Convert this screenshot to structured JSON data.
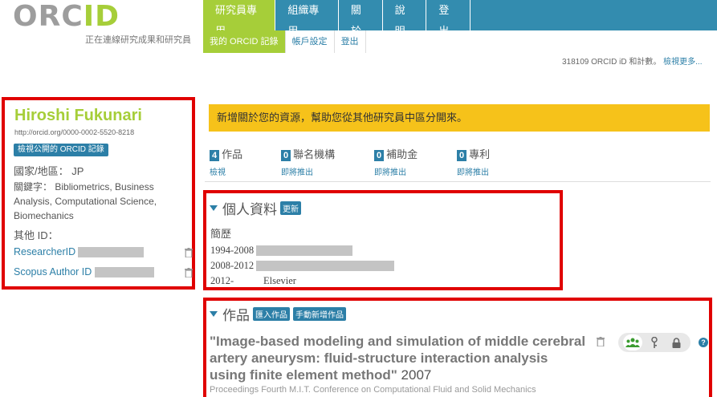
{
  "logo": {
    "brand": "ORCID",
    "tagline": "正在連線研究成果和研究員"
  },
  "nav": {
    "main": [
      "研究員專用",
      "組織專用",
      "關於",
      "說明",
      "登出"
    ],
    "sub": [
      "我的 ORCID 記錄",
      "帳戶設定",
      "登出"
    ],
    "count_text": "318109 ORCID iD 和計數。",
    "count_link": "檢視更多..."
  },
  "profile": {
    "name": "Hiroshi Fukunari",
    "orcid_url": "http://orcid.org/0000-0002-5520-8218",
    "public_button": "檢視公開的 ORCID 記錄",
    "country_label": "國家/地區：",
    "country_value": "JP",
    "keywords_label": "關鍵字：",
    "keywords_value": "Bibliometrics, Business Analysis, Computational Science, Biomechanics",
    "other_ids_label": "其他 ID：",
    "ids": [
      "ResearcherID",
      "Scopus Author ID"
    ]
  },
  "banner": "新增關於您的資源，幫助您從其他研究員中區分開來。",
  "stats": [
    {
      "count": "4",
      "label": "作品",
      "sub": "檢視"
    },
    {
      "count": "0",
      "label": "聯名機構",
      "sub": "即將推出"
    },
    {
      "count": "0",
      "label": "補助金",
      "sub": "即將推出"
    },
    {
      "count": "0",
      "label": "專利",
      "sub": "即將推出"
    }
  ],
  "personal": {
    "title": "個人資料",
    "update": "更新",
    "employment_label": "簡歷",
    "rows": [
      {
        "years": "1994-2008",
        "org": ""
      },
      {
        "years": "2008-2012",
        "org": ""
      },
      {
        "years": "2012-",
        "org": "Elsevier"
      }
    ]
  },
  "works": {
    "title": "作品",
    "import_btn": "匯入作品",
    "manual_btn": "手動新增作品",
    "item_title": "\"Image-based modeling and simulation of middle cerebral artery aneurysm: fluid-structure interaction analysis using finite element method\"",
    "item_year": "2007",
    "item_source": "Proceedings Fourth M.I.T. Conference on Computational Fluid and Solid Mechanics"
  },
  "colors": {
    "accent_green": "#a6ce39",
    "nav_blue": "#338caf",
    "banner_yellow": "#f6c21a",
    "highlight_red": "#e00000"
  }
}
